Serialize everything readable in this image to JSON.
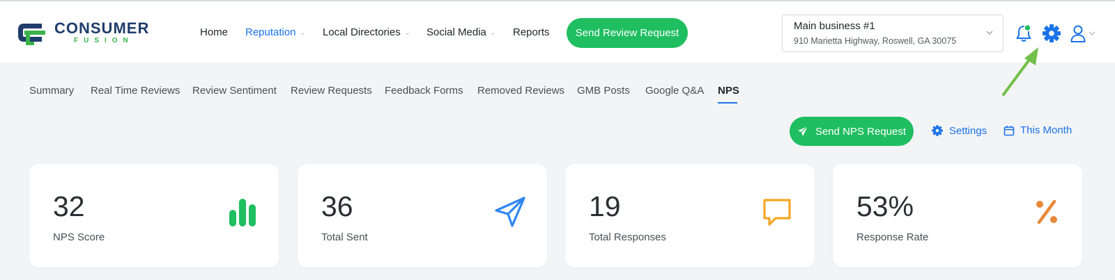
{
  "brand": {
    "name": "CONSUMER",
    "sub": "FUSION",
    "color_primary": "#1f3d6b",
    "color_accent": "#3bb34a"
  },
  "nav": {
    "items": [
      {
        "label": "Home",
        "active": false,
        "dropdown": false
      },
      {
        "label": "Reputation",
        "active": true,
        "dropdown": true
      },
      {
        "label": "Local Directories",
        "active": false,
        "dropdown": true
      },
      {
        "label": "Social Media",
        "active": false,
        "dropdown": true
      },
      {
        "label": "Reports",
        "active": false,
        "dropdown": false
      }
    ],
    "cta_label": "Send Review Request"
  },
  "business": {
    "name": "Main business #1",
    "address": "910 Marietta Highway, Roswell, GA 30075"
  },
  "header_icons": [
    "bell-icon",
    "gear-icon",
    "user-icon"
  ],
  "tabs": [
    {
      "label": "Summary",
      "active": false
    },
    {
      "label": "Real Time Reviews",
      "active": false
    },
    {
      "label": "Review Sentiment",
      "active": false
    },
    {
      "label": "Review Requests",
      "active": false
    },
    {
      "label": "Feedback Forms",
      "active": false
    },
    {
      "label": "Removed Reviews",
      "active": false
    },
    {
      "label": "GMB Posts",
      "active": false
    },
    {
      "label": "Google Q&A",
      "active": false
    },
    {
      "label": "NPS",
      "active": true
    }
  ],
  "actions": {
    "send_nps_label": "Send NPS Request",
    "settings_label": "Settings",
    "period_label": "This Month"
  },
  "stats": [
    {
      "value": "32",
      "label": "NPS Score",
      "icon": "bar-chart-icon",
      "color": "#1fbe60"
    },
    {
      "value": "36",
      "label": "Total Sent",
      "icon": "paper-plane-icon",
      "color": "#2f86f0"
    },
    {
      "value": "19",
      "label": "Total Responses",
      "icon": "chat-bubble-icon",
      "color": "#f5a623"
    },
    {
      "value": "53%",
      "label": "Response Rate",
      "icon": "percent-icon",
      "color": "#e8883a"
    }
  ],
  "colors": {
    "accent_blue": "#1a73e8",
    "button_green": "#1fbe60",
    "background": "#f3f4f6"
  }
}
